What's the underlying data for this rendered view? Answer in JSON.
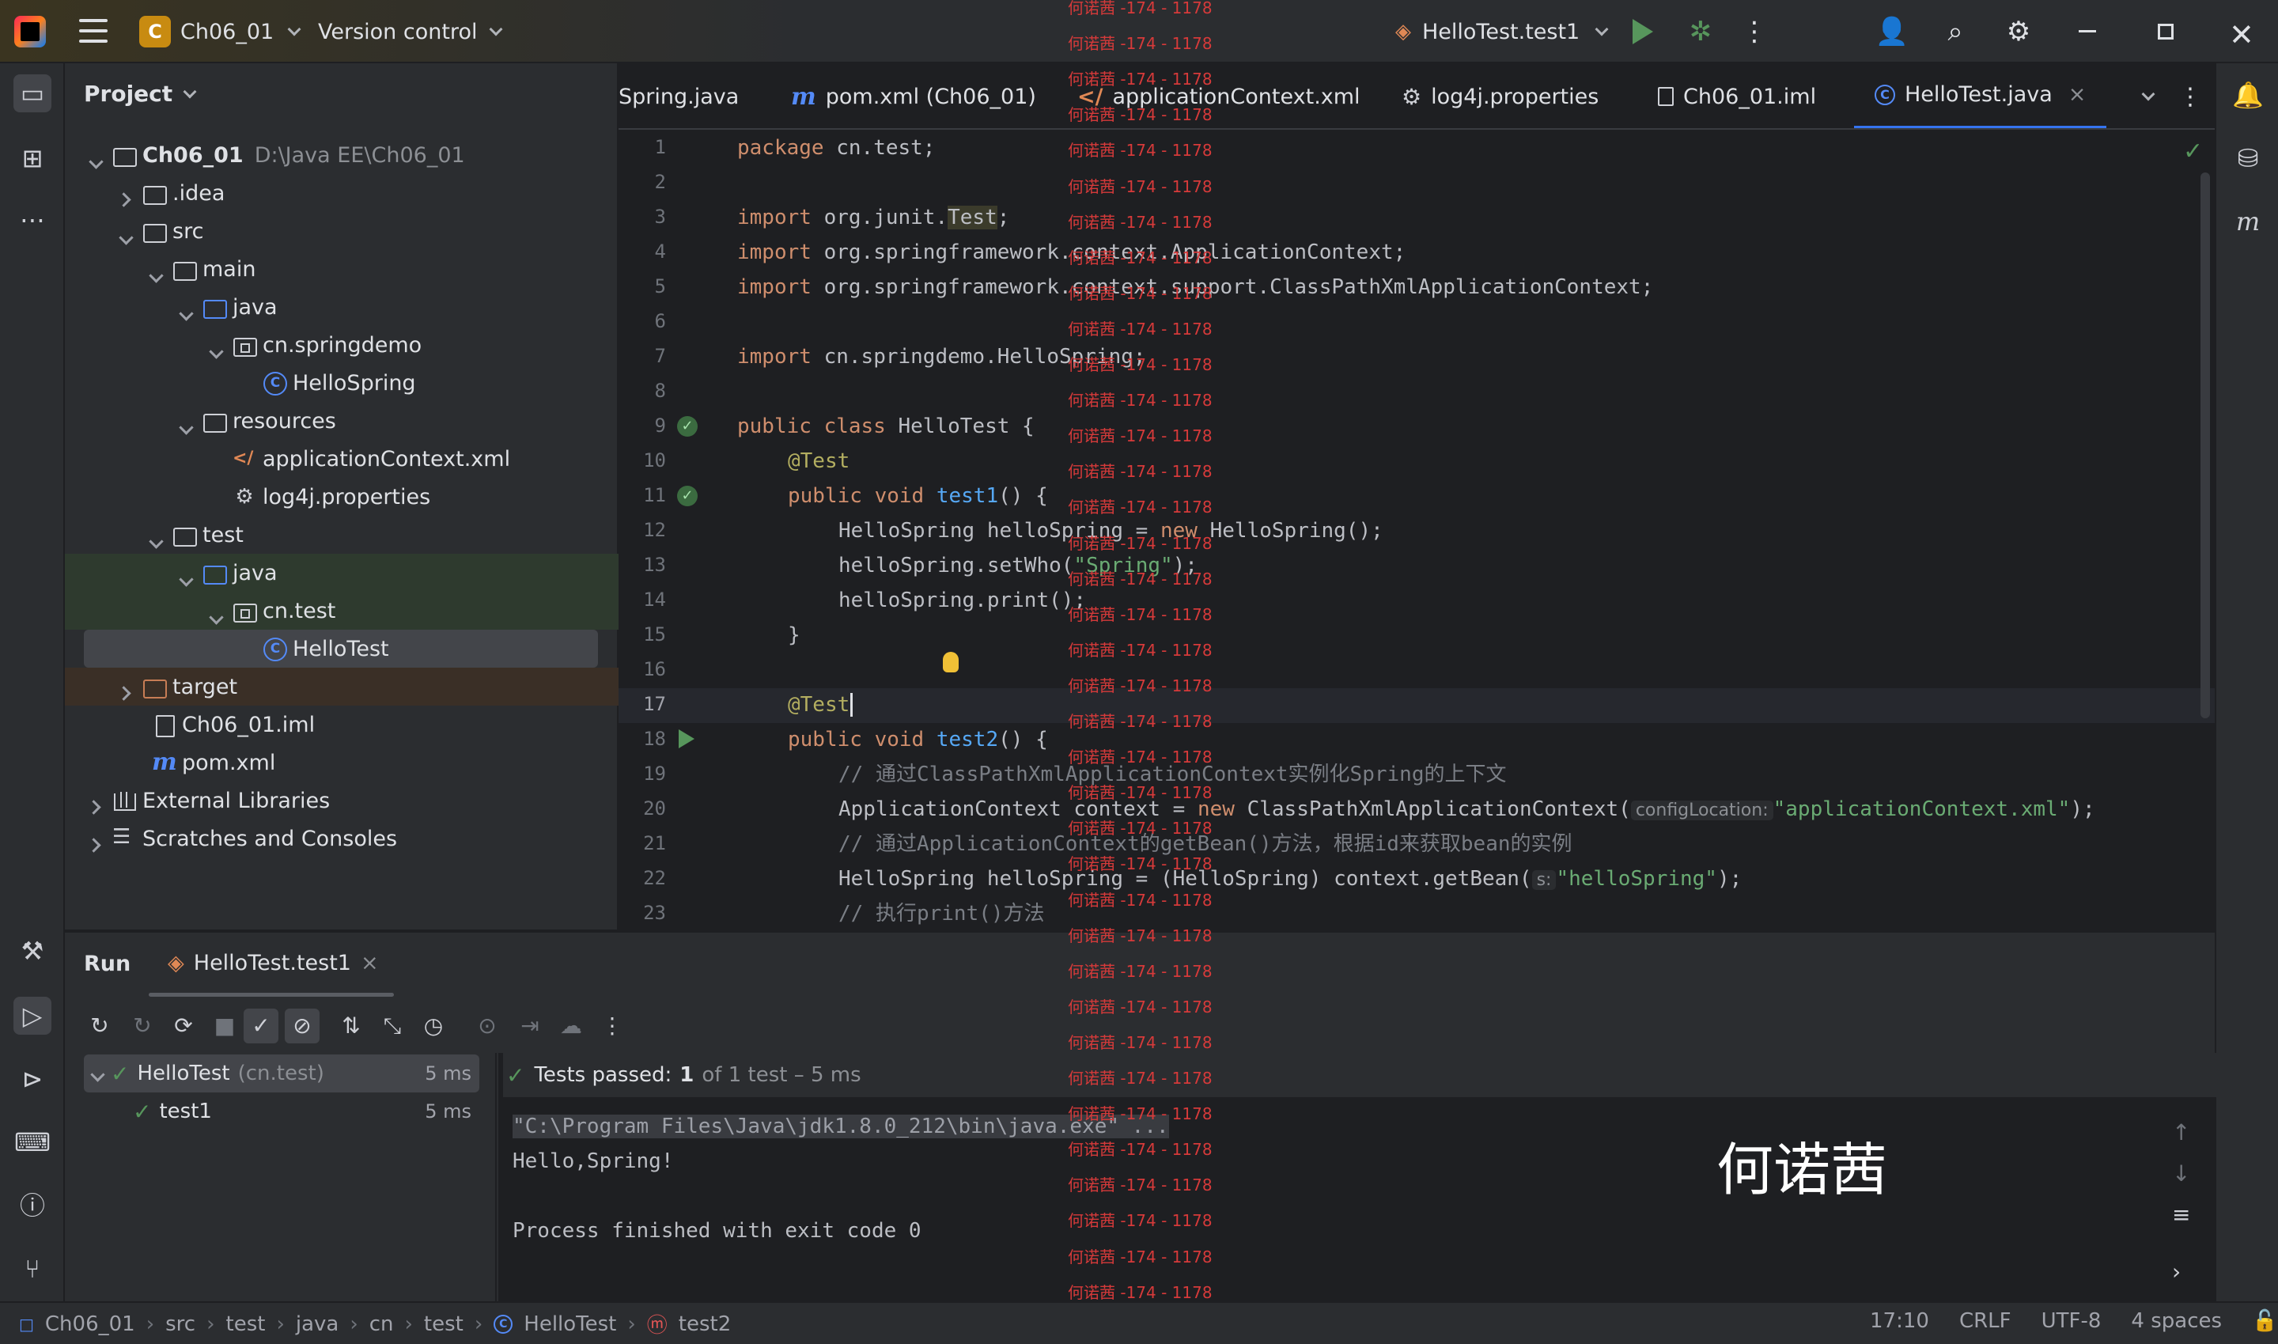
{
  "titlebar": {
    "project_badge": "C",
    "project_name": "Ch06_01",
    "vcs_label": "Version control",
    "run_config": "HelloTest.test1"
  },
  "project_pane": {
    "title": "Project",
    "tree": [
      {
        "label": "Ch06_01",
        "path": "D:\\Java EE\\Ch06_01"
      },
      {
        "label": ".idea"
      },
      {
        "label": "src"
      },
      {
        "label": "main"
      },
      {
        "label": "java"
      },
      {
        "label": "cn.springdemo"
      },
      {
        "label": "HelloSpring"
      },
      {
        "label": "resources"
      },
      {
        "label": "applicationContext.xml"
      },
      {
        "label": "log4j.properties"
      },
      {
        "label": "test"
      },
      {
        "label": "java"
      },
      {
        "label": "cn.test"
      },
      {
        "label": "HelloTest"
      },
      {
        "label": "target"
      },
      {
        "label": "Ch06_01.iml"
      },
      {
        "label": "pom.xml"
      },
      {
        "label": "External Libraries"
      },
      {
        "label": "Scratches and Consoles"
      }
    ]
  },
  "editor_tabs": [
    {
      "label": "Spring.java"
    },
    {
      "label": "pom.xml (Ch06_01)"
    },
    {
      "label": "applicationContext.xml"
    },
    {
      "label": "log4j.properties"
    },
    {
      "label": "Ch06_01.iml"
    },
    {
      "label": "HelloTest.java",
      "close": "×"
    }
  ],
  "editor": {
    "line_numbers": [
      "1",
      "2",
      "3",
      "4",
      "5",
      "6",
      "7",
      "8",
      "9",
      "10",
      "11",
      "12",
      "13",
      "14",
      "15",
      "16",
      "17",
      "18",
      "19",
      "20",
      "21",
      "22",
      "23"
    ],
    "code": {
      "l1_kw": "package",
      "l1_rest": " cn.test;",
      "l3_kw": "import",
      "l3_a": " org.junit.",
      "l3_b": "Test",
      "l3_c": ";",
      "l4_kw": "import",
      "l4_rest": " org.springframework.context.ApplicationContext;",
      "l5_kw": "import",
      "l5_rest": " org.springframework.context.support.ClassPathXmlApplicationContext;",
      "l7_kw": "import",
      "l7_rest": " cn.springdemo.HelloSpring;",
      "l9_kw": "public class",
      "l9_rest": " HelloTest {",
      "l10_ann": "@Test",
      "l11_kw": "public void",
      "l11_fn": " test1",
      "l11_rest": "() {",
      "l12_a": "HelloSpring helloSpring = ",
      "l12_kw": "new",
      "l12_b": " HelloSpring();",
      "l13_a": "helloSpring.setWho(",
      "l13_str": "\"Spring\"",
      "l13_b": ");",
      "l14": "helloSpring.print();",
      "l15": "}",
      "l17_ann": "@Test",
      "l18_kw": "public void",
      "l18_fn": " test2",
      "l18_rest": "() {",
      "l19_cmt": "// 通过ClassPathXmlApplicationContext实例化Spring的上下文",
      "l20_a": "ApplicationContext context = ",
      "l20_kw": "new",
      "l20_b": " ClassPathXmlApplicationContext(",
      "l20_hint": "configLocation:",
      "l20_str": "\"applicationContext.xml\"",
      "l20_c": ");",
      "l21_cmt": "// 通过ApplicationContext的getBean()方法，根据id来获取bean的实例",
      "l22_a": "HelloSpring helloSpring = (HelloSpring) context.getBean(",
      "l22_hint": "s:",
      "l22_str": "\"helloSpring\"",
      "l22_b": ");",
      "l23_cmt": "// 执行print()方法"
    }
  },
  "watermark": {
    "repeat_text": "何诺茜 -174 - 1178",
    "name": "何诺茜"
  },
  "run_pane": {
    "title": "Run",
    "tab_label": "HelloTest.test1",
    "tab_close": "×",
    "tree": {
      "suite_label": "HelloTest",
      "suite_pkg": "(cn.test)",
      "suite_time": "5 ms",
      "test_label": "test1",
      "test_time": "5 ms"
    },
    "summary": {
      "prefix": "Tests passed:",
      "count": "1",
      "suffix": "of 1 test – 5 ms"
    },
    "console": [
      "\"C:\\Program Files\\Java\\jdk1.8.0_212\\bin\\java.exe\" ...",
      "Hello,Spring!",
      "",
      "Process finished with exit code 0"
    ]
  },
  "statusbar": {
    "breadcrumb": [
      "Ch06_01",
      "src",
      "test",
      "java",
      "cn",
      "test",
      "HelloTest",
      "test2"
    ],
    "position": "17:10",
    "line_sep": "CRLF",
    "encoding": "UTF-8",
    "indent": "4 spaces"
  },
  "colors": {
    "accent": "#3574f0",
    "run_green": "#57965c",
    "watermark_red": "#d63a3a"
  }
}
